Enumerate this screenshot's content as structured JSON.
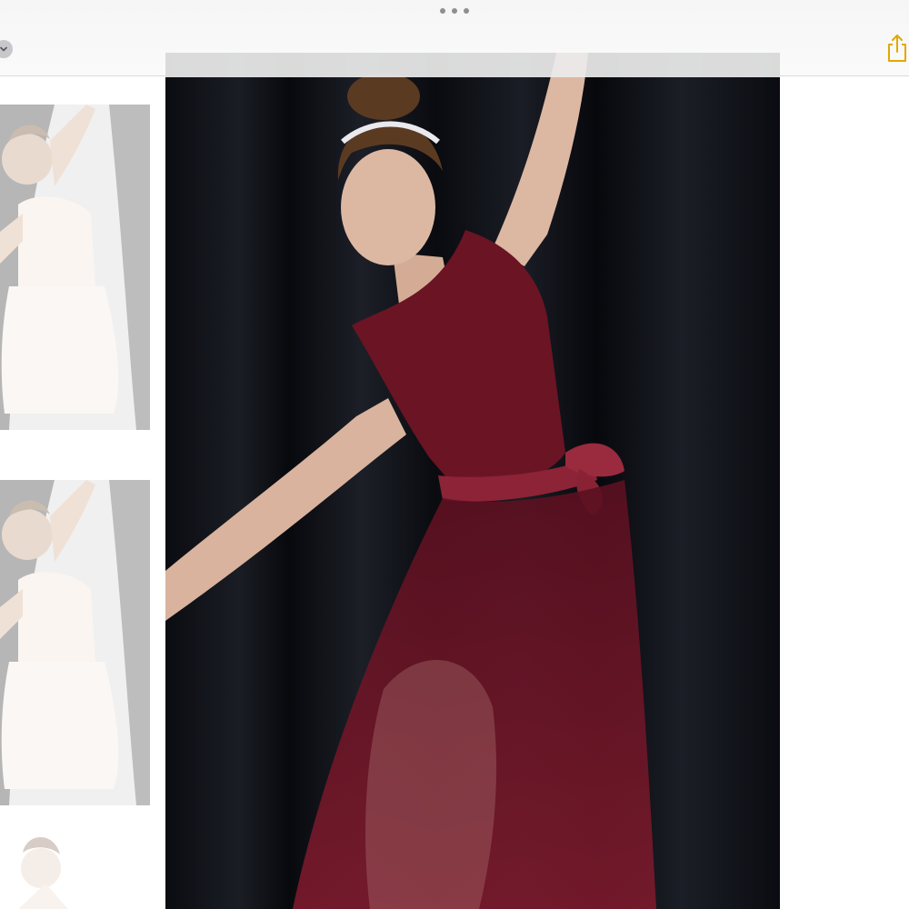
{
  "toolbar": {
    "grabber_icon": "more-dots-icon",
    "left_icon": "chevron-down-icon",
    "right_icon": "share-icon",
    "accent_color": "#e2a800"
  },
  "sidebar": {
    "thumbnails": [
      {
        "icon": "photo-thumbnail"
      },
      {
        "icon": "photo-thumbnail"
      },
      {
        "icon": "photo-thumbnail"
      }
    ]
  },
  "viewer": {
    "subject": "dancer-photo",
    "dress_color": "#6e1524",
    "backdrop_color": "#0b0d12"
  }
}
